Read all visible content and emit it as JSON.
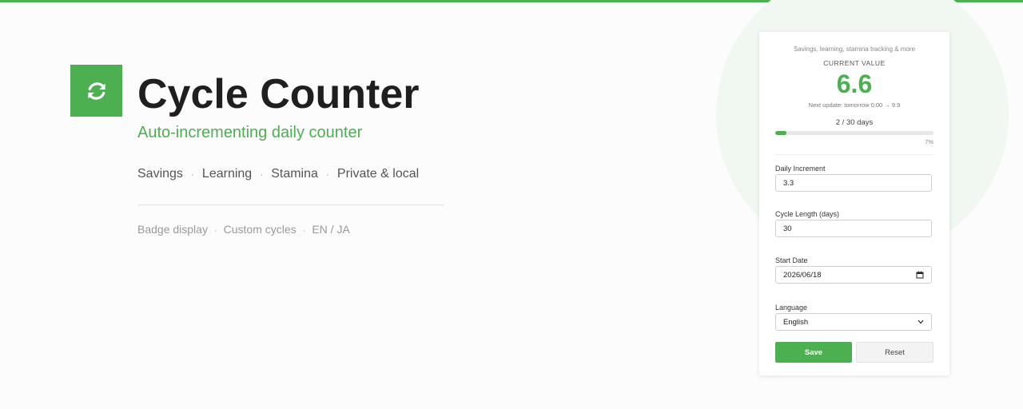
{
  "hero": {
    "title": "Cycle Counter",
    "subtitle": "Auto-incrementing daily counter",
    "features": [
      "Savings",
      "Learning",
      "Stamina",
      "Private & local"
    ],
    "extras": [
      "Badge display",
      "Custom cycles",
      "EN / JA"
    ]
  },
  "panel": {
    "tagline": "Savings, learning, stamina tracking & more",
    "current_label": "CURRENT VALUE",
    "current_value": "6.6",
    "next_update": "Next update: tomorrow 0:00 → 9.9",
    "days_progress": "2 / 30 days",
    "progress_fraction": 0.07,
    "progress_percent": "7%",
    "fields": {
      "daily_increment": {
        "label": "Daily Increment",
        "value": "3.3"
      },
      "cycle_length": {
        "label": "Cycle Length (days)",
        "value": "30"
      },
      "start_date": {
        "label": "Start Date",
        "value": "2026/06/18"
      },
      "language": {
        "label": "Language",
        "value": "English"
      }
    },
    "save_label": "Save",
    "reset_label": "Reset"
  },
  "colors": {
    "accent": "#4caf50",
    "background_circle": "#f1f7f1"
  },
  "icons": {
    "logo": "refresh-cycle-icon",
    "calendar": "calendar-icon",
    "dropdown": "chevron-down-icon"
  }
}
